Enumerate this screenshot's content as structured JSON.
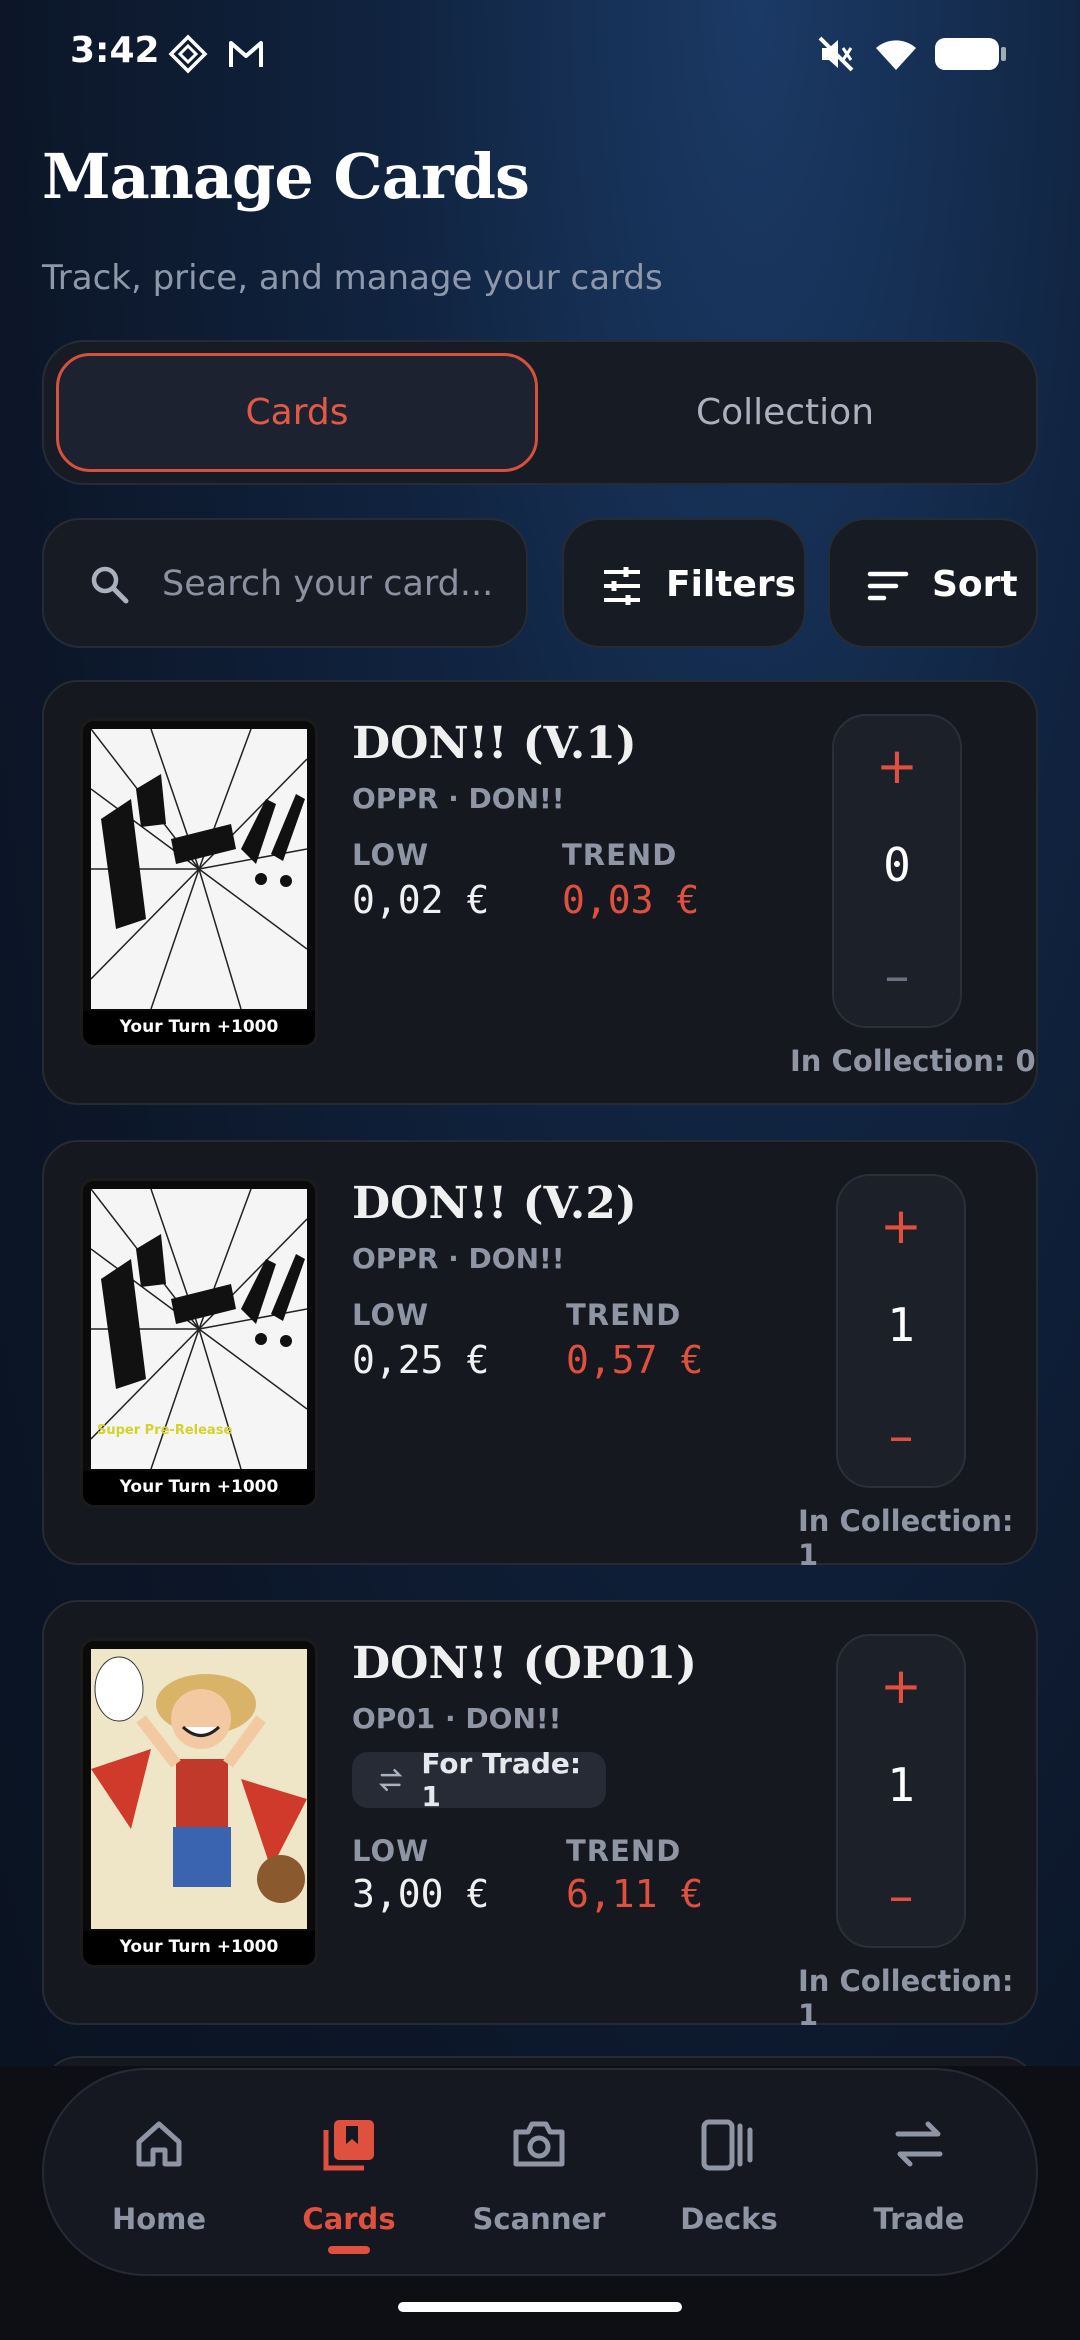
{
  "status_bar": {
    "time": "3:42"
  },
  "header": {
    "title": "Manage Cards",
    "subtitle": "Track, price, and manage your cards"
  },
  "segmented": {
    "cards": "Cards",
    "collection": "Collection",
    "active": "Cards"
  },
  "toolbar": {
    "search_placeholder": "Search your card...",
    "filters_label": "Filters",
    "sort_label": "Sort"
  },
  "labels": {
    "low": "LOW",
    "trend": "TREND"
  },
  "cards": [
    {
      "name": "DON!! (V.1)",
      "set": "OPPR · DON!!",
      "low": "0,02 €",
      "trend": "0,03 €",
      "count": "0",
      "in_collection": "In Collection: 0",
      "thumb_footer": "Your Turn  +1000"
    },
    {
      "name": "DON!! (V.2)",
      "set": "OPPR · DON!!",
      "low": "0,25 €",
      "trend": "0,57 €",
      "count": "1",
      "in_collection": "In Collection: 1",
      "thumb_footer": "Your Turn  +1000",
      "thumb_tag": "Super Pre-Release"
    },
    {
      "name": "DON!! (OP01)",
      "set": "OP01 · DON!!",
      "trade": "For Trade: 1",
      "low": "3,00 €",
      "trend": "6,11 €",
      "count": "1",
      "in_collection": "In Collection: 1",
      "thumb_footer": "Your Turn  +1000"
    }
  ],
  "nav": {
    "items": [
      {
        "label": "Home",
        "icon": "home-icon"
      },
      {
        "label": "Cards",
        "icon": "cards-icon"
      },
      {
        "label": "Scanner",
        "icon": "camera-icon"
      },
      {
        "label": "Decks",
        "icon": "decks-icon"
      },
      {
        "label": "Trade",
        "icon": "trade-icon"
      }
    ],
    "active": "Cards"
  },
  "colors": {
    "accent": "#e0503e",
    "background": "#0c1628",
    "card": "#15181f"
  }
}
